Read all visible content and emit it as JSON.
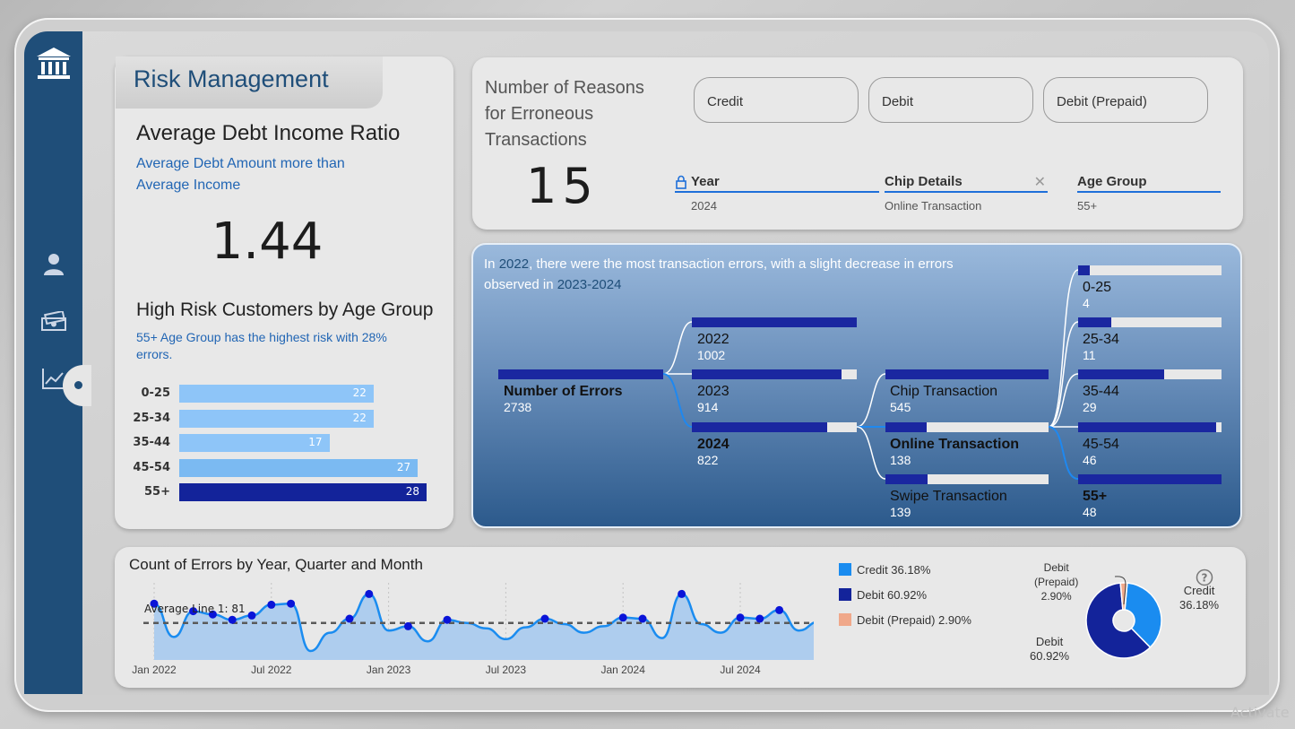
{
  "dashboard": {
    "title": "Risk Management"
  },
  "debt_ratio": {
    "title": "Average Debt Income Ratio",
    "subtitle_line1": "Average Debt Amount more than",
    "subtitle_line2": "Average Income",
    "value": "1.44"
  },
  "age_risk": {
    "title": "High Risk Customers by Age Group",
    "subtitle_line1": "55+ Age Group has the highest risk with 28%",
    "subtitle_line2": "errors.",
    "rows": [
      {
        "label": "0-25",
        "value": 22
      },
      {
        "label": "25-34",
        "value": 22
      },
      {
        "label": "35-44",
        "value": 17
      },
      {
        "label": "45-54",
        "value": 27
      },
      {
        "label": "55+",
        "value": 28
      }
    ],
    "colors": [
      "#8ec5f8",
      "#8ec5f8",
      "#8ec5f8",
      "#7bbaf2",
      "#13239a"
    ]
  },
  "reasons": {
    "title_line1": "Number of Reasons",
    "title_line2": "for Erroneous",
    "title_line3": "Transactions",
    "value": "15",
    "pills": [
      "Credit",
      "Debit",
      "Debit (Prepaid)"
    ],
    "slicers": [
      {
        "label": "Year",
        "value": "2024"
      },
      {
        "label": "Chip Details",
        "value": "Online Transaction"
      },
      {
        "label": "Age Group",
        "value": "55+"
      }
    ]
  },
  "tree": {
    "note_pre": "In ",
    "note_year": "2022",
    "note_mid": ", there were the most transaction errors, with a slight decrease in errors observed in ",
    "note_range": "2023-2024",
    "root": {
      "label": "Number of Errors",
      "value": "2738"
    },
    "years": [
      {
        "label": "2022",
        "value": "1002",
        "fill": 1.0
      },
      {
        "label": "2023",
        "value": "914",
        "fill": 0.91
      },
      {
        "label": "2024",
        "value": "822",
        "fill": 0.82
      }
    ],
    "chips": [
      {
        "label": "Chip Transaction",
        "value": "545",
        "fill": 1.0
      },
      {
        "label": "Online Transaction",
        "value": "138",
        "fill": 0.25
      },
      {
        "label": "Swipe Transaction",
        "value": "139",
        "fill": 0.26
      }
    ],
    "ages": [
      {
        "label": "0-25",
        "value": "4",
        "fill": 0.08
      },
      {
        "label": "25-34",
        "value": "11",
        "fill": 0.23
      },
      {
        "label": "35-44",
        "value": "29",
        "fill": 0.6
      },
      {
        "label": "45-54",
        "value": "46",
        "fill": 0.96
      },
      {
        "label": "55+",
        "value": "48",
        "fill": 1.0
      }
    ]
  },
  "errors_chart": {
    "title": "Count of Errors by Year, Quarter and Month",
    "average_label": "Average Line 1: 81",
    "x_labels": [
      "Jan 2022",
      "Jul 2022",
      "Jan 2023",
      "Jul 2023",
      "Jan 2024",
      "Jul 2024"
    ]
  },
  "chart_data": {
    "type": "area",
    "title": "Count of Errors by Year, Quarter and Month",
    "x": [
      "2022-01",
      "2022-02",
      "2022-03",
      "2022-04",
      "2022-05",
      "2022-06",
      "2022-07",
      "2022-08",
      "2022-09",
      "2022-10",
      "2022-11",
      "2022-12",
      "2023-01",
      "2023-02",
      "2023-03",
      "2023-04",
      "2023-05",
      "2023-06",
      "2023-07",
      "2023-08",
      "2023-09",
      "2023-10",
      "2023-11",
      "2023-12",
      "2024-01",
      "2024-02",
      "2024-03",
      "2024-04",
      "2024-05",
      "2024-06",
      "2024-07",
      "2024-08",
      "2024-09",
      "2024-10",
      "2024-11",
      "2024-12"
    ],
    "values": [
      99,
      68,
      92,
      89,
      84,
      88,
      98,
      99,
      55,
      72,
      85,
      108,
      74,
      78,
      64,
      84,
      81,
      76,
      66,
      77,
      85,
      80,
      72,
      78,
      86,
      85,
      67,
      108,
      80,
      72,
      86,
      85,
      93,
      74,
      82,
      86
    ],
    "average": 81,
    "x_ticks": [
      "Jan 2022",
      "Jul 2022",
      "Jan 2023",
      "Jul 2023",
      "Jan 2024",
      "Jul 2024"
    ]
  },
  "card_share": {
    "legend": [
      {
        "label": "Credit 36.18%",
        "color": "#1a8cf0"
      },
      {
        "label": "Debit 60.92%",
        "color": "#13239a"
      },
      {
        "label": "Debit (Prepaid) 2.90%",
        "color": "#f0a88a"
      }
    ],
    "slices": [
      {
        "name": "Credit",
        "value": 36.18,
        "color": "#1a8cf0"
      },
      {
        "name": "Debit",
        "value": 60.92,
        "color": "#13239a"
      },
      {
        "name": "Debit (Prepaid)",
        "value": 2.9,
        "color": "#f0a88a"
      }
    ],
    "labels": {
      "credit_name": "Credit",
      "credit_pct": "36.18%",
      "debit_name": "Debit",
      "debit_pct": "60.92%",
      "prepaid_name1": "Debit",
      "prepaid_name2": "(Prepaid)",
      "prepaid_pct": "2.90%"
    }
  },
  "watermark": "Activate"
}
